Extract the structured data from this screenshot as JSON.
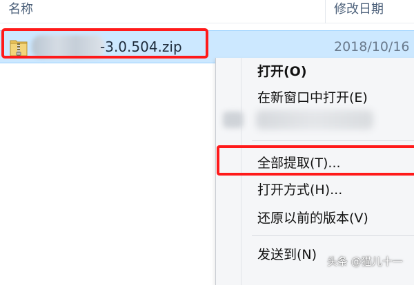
{
  "header": {
    "name_col": "名称",
    "date_col": "修改日期"
  },
  "file": {
    "icon": "zip-archive-icon",
    "name_visible": "-3.0.504.zip",
    "date": "2018/10/16"
  },
  "context_menu": {
    "items": [
      {
        "label": "打开(O)",
        "bold": true
      },
      {
        "label": "在新窗口中打开(E)"
      },
      {
        "label": "全部提取(T)..."
      },
      {
        "label": "打开方式(H)..."
      },
      {
        "label": "还原以前的版本(V)"
      },
      {
        "label": "发送到(N)"
      }
    ]
  },
  "watermark": "头条 @猫儿十一",
  "colors": {
    "selection": "#cce8ff",
    "highlight_box": "#ff1a1a",
    "menu_bg": "#f5f6f8"
  }
}
